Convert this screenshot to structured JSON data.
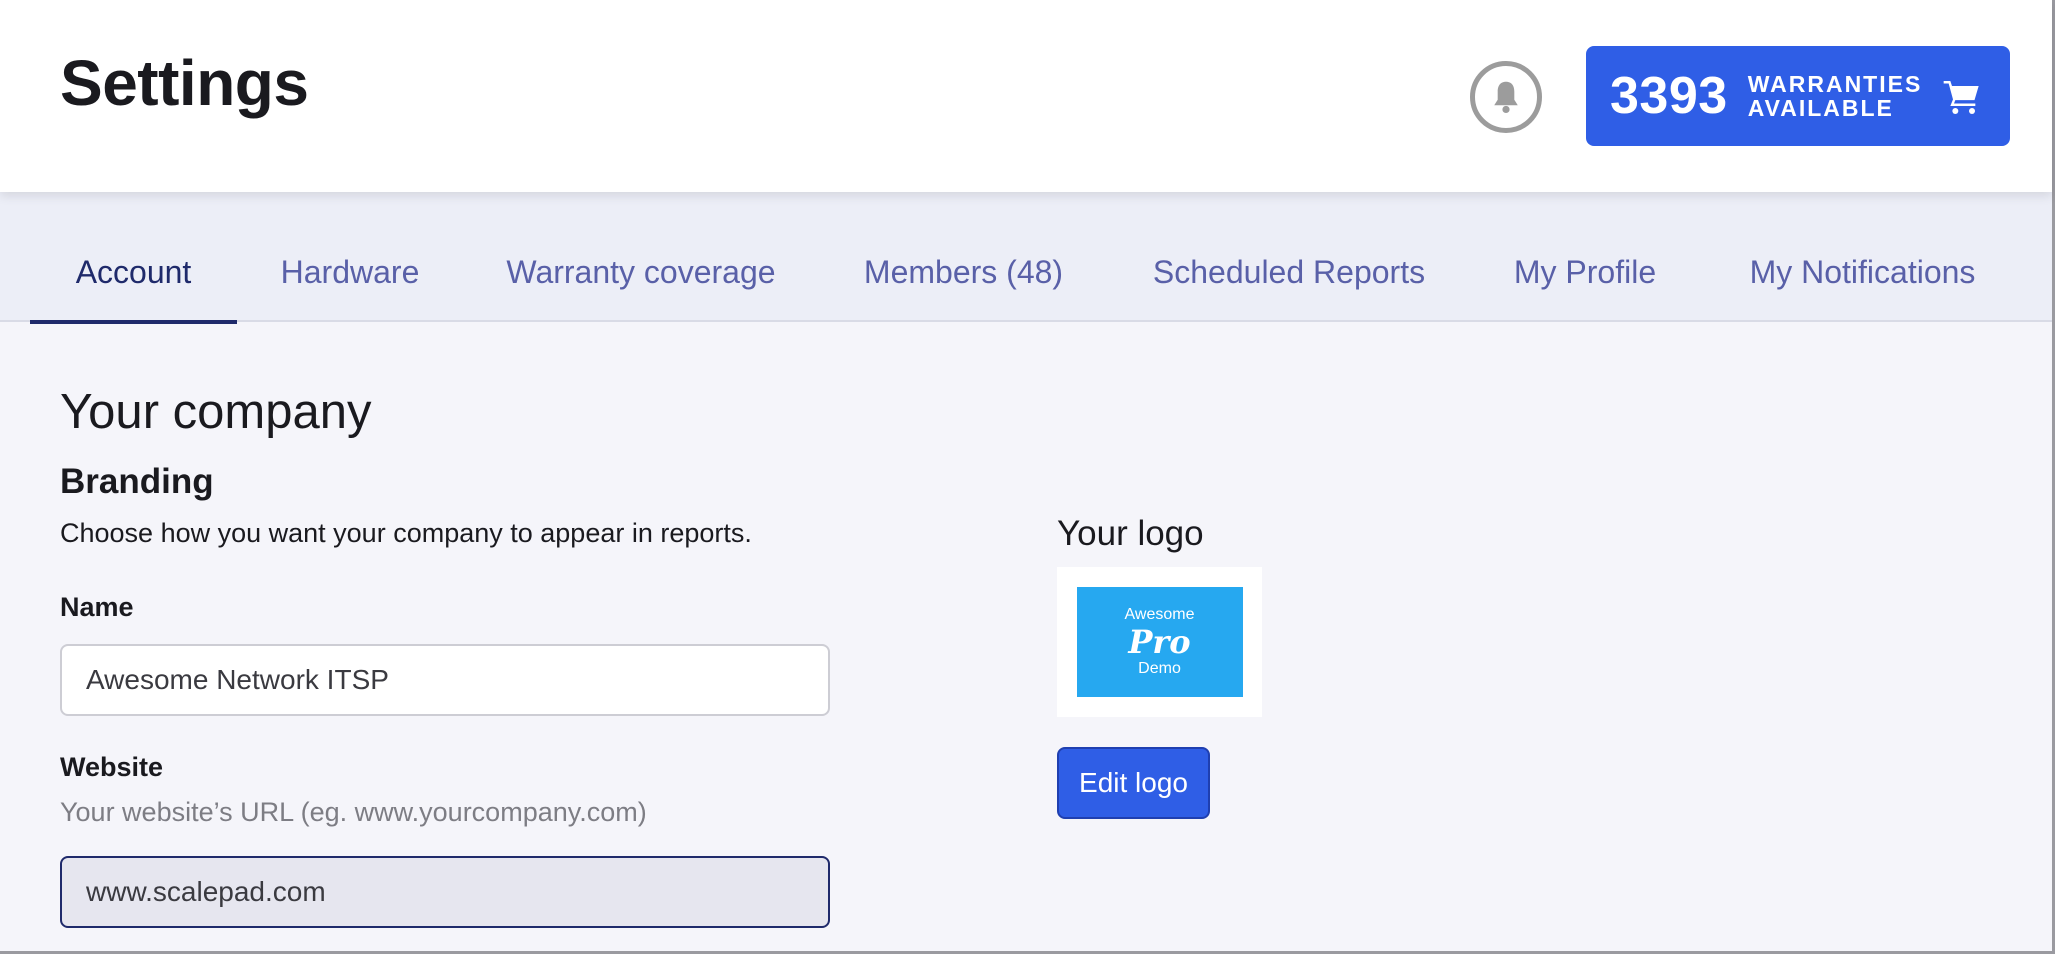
{
  "header": {
    "title": "Settings",
    "cta": {
      "count": "3393",
      "label_line1": "WARRANTIES",
      "label_line2": "AVAILABLE"
    }
  },
  "tabs": [
    {
      "label": "Account",
      "active": true
    },
    {
      "label": "Hardware"
    },
    {
      "label": "Warranty coverage"
    },
    {
      "label": "Members (48)"
    },
    {
      "label": "Scheduled Reports"
    },
    {
      "label": "My Profile"
    },
    {
      "label": "My Notifications"
    }
  ],
  "main": {
    "section_title": "Your company",
    "branding": {
      "title": "Branding",
      "description": "Choose how you want your company to appear in reports.",
      "name_label": "Name",
      "name_value": "Awesome Network ITSP",
      "website_label": "Website",
      "website_hint": "Your website’s URL (eg. www.yourcompany.com)",
      "website_value": "www.scalepad.com"
    },
    "logo": {
      "title": "Your logo",
      "image_text_top": "Awesome",
      "image_text_mid": "Pro",
      "image_text_bottom": "Demo",
      "edit_label": "Edit logo"
    }
  },
  "colors": {
    "accent": "#2f5ee6",
    "tab_active": "#1f2a6b",
    "tab_inactive": "#5960a8"
  },
  "icons": {
    "bell": "bell-icon",
    "cart": "cart-icon"
  }
}
